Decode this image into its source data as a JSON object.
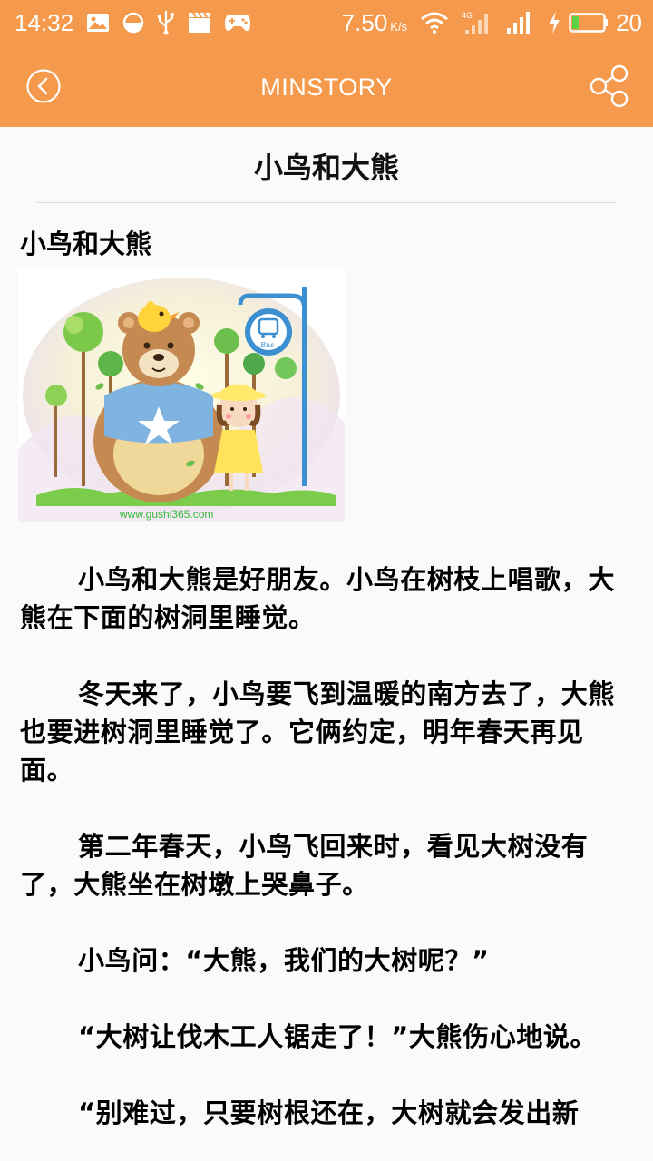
{
  "status_bar": {
    "time": "14:32",
    "net_speed": "7.50",
    "net_unit": "K/s",
    "network_type": "4G",
    "battery_level": "20",
    "icons_left": [
      "image-icon",
      "circle-half-icon",
      "usb-icon",
      "clapperboard-icon",
      "gamepad-icon"
    ],
    "icons_right": [
      "wifi-icon",
      "signal-4g-icon",
      "signal-icon",
      "charging-icon",
      "battery-icon"
    ]
  },
  "app_bar": {
    "title": "MINSTORY",
    "back_icon": "back-icon",
    "share_icon": "share-icon"
  },
  "article": {
    "title": "小鸟和大熊",
    "heading": "小鸟和大熊",
    "image_watermark": "www.gushi365.com",
    "image_sign_text": "Bus",
    "paragraphs": [
      "小鸟和大熊是好朋友。小鸟在树枝上唱歌，大熊在下面的树洞里睡觉。",
      "冬天来了，小鸟要飞到温暖的南方去了，大熊也要进树洞里睡觉了。它俩约定，明年春天再见面。",
      "第二年春天，小鸟飞回来时，看见大树没有了，大熊坐在树墩上哭鼻子。",
      "小鸟问：“大熊，我们的大树呢？”",
      "“大树让伐木工人锯走了！”大熊伤心地说。",
      "“别难过，只要树根还在，大树就会发出新"
    ]
  },
  "colors": {
    "accent": "#f59a4c",
    "text": "#000000",
    "background": "#fafafa"
  }
}
